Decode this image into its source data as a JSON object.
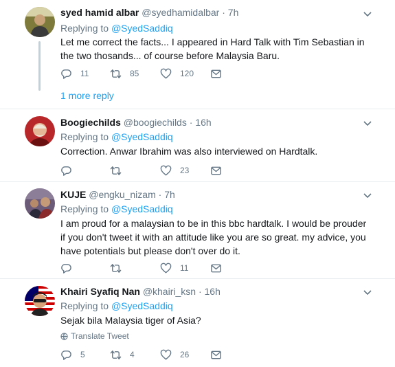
{
  "tweets": [
    {
      "name": "syed hamid albar",
      "handle": "@syedhamidalbar",
      "separator": "·",
      "time": "7h",
      "replying_prefix": "Replying to",
      "replying_to": "@SyedSaddiq",
      "text": "Let me correct the facts... I appeared in Hard Talk with Tim Sebastian in the two thosands... of course before Malaysia Baru.",
      "replies": "11",
      "retweets": "85",
      "likes": "120",
      "more_reply": "1 more reply",
      "avatar_colors": {
        "bg": "#8a7a3a",
        "face": "#c9a27a"
      }
    },
    {
      "name": "Boogiechilds",
      "handle": "@boogiechilds",
      "separator": "·",
      "time": "16h",
      "replying_prefix": "Replying to",
      "replying_to": "@SyedSaddiq",
      "text": "Correction. Anwar Ibrahim was also interviewed on Hardtalk.",
      "replies": "",
      "retweets": "",
      "likes": "23",
      "avatar_colors": {
        "bg": "#c0392b",
        "face": "#e8b89a"
      }
    },
    {
      "name": "KUJE",
      "handle": "@engku_nizam",
      "separator": "·",
      "time": "7h",
      "replying_prefix": "Replying to",
      "replying_to": "@SyedSaddiq",
      "text": "I am proud for a malaysian to be in this bbc hardtalk. I would be prouder if you don't tweet it with an attitude like you are so great. my advice, you have potentials but please don't over do it.",
      "replies": "",
      "retweets": "",
      "likes": "11",
      "avatar_colors": {
        "bg": "#5a4a6a",
        "face": "#b48a6a"
      }
    },
    {
      "name": "Khairi Syafiq Nan",
      "handle": "@khairi_ksn",
      "separator": "·",
      "time": "16h",
      "replying_prefix": "Replying to",
      "replying_to": "@SyedSaddiq",
      "text": "Sejak bila Malaysia tiger of Asia?",
      "translate": "Translate Tweet",
      "replies": "5",
      "retweets": "4",
      "likes": "26",
      "avatar_colors": {
        "bg": "#1a3a8a",
        "face": "#d9a47a"
      }
    }
  ],
  "colors": {
    "accent": "#1da1f2",
    "muted": "#657786",
    "text": "#14171a",
    "border": "#e6ecf0"
  },
  "icons": [
    "reply-icon",
    "retweet-icon",
    "like-icon",
    "direct-message-icon",
    "chevron-down-icon",
    "globe-icon"
  ]
}
